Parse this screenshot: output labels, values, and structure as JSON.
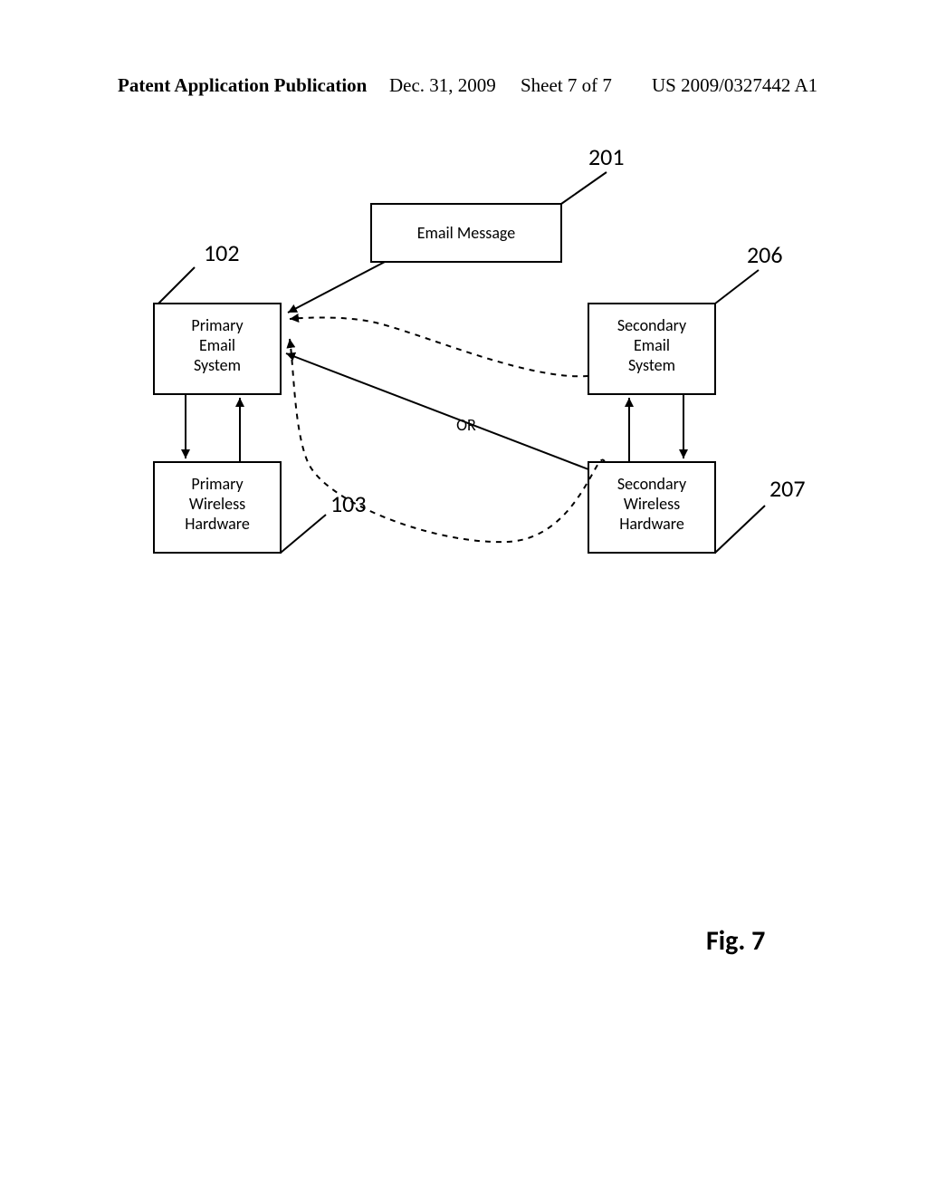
{
  "header": {
    "pub": "Patent Application Publication",
    "date": "Dec. 31, 2009",
    "sheet": "Sheet 7 of 7",
    "docnum": "US 2009/0327442 A1"
  },
  "figure_label": "Fig. 7",
  "refs": {
    "r201": "201",
    "r102": "102",
    "r206": "206",
    "r103": "103",
    "r207": "207"
  },
  "boxes": {
    "email_message": "Email Message",
    "primary_email_l1": "Primary",
    "primary_email_l2": "Email",
    "primary_email_l3": "System",
    "secondary_email_l1": "Secondary",
    "secondary_email_l2": "Email",
    "secondary_email_l3": "System",
    "primary_hw_l1": "Primary",
    "primary_hw_l2": "Wireless",
    "primary_hw_l3": "Hardware",
    "secondary_hw_l1": "Secondary",
    "secondary_hw_l2": "Wireless",
    "secondary_hw_l3": "Hardware",
    "or": "OR"
  }
}
